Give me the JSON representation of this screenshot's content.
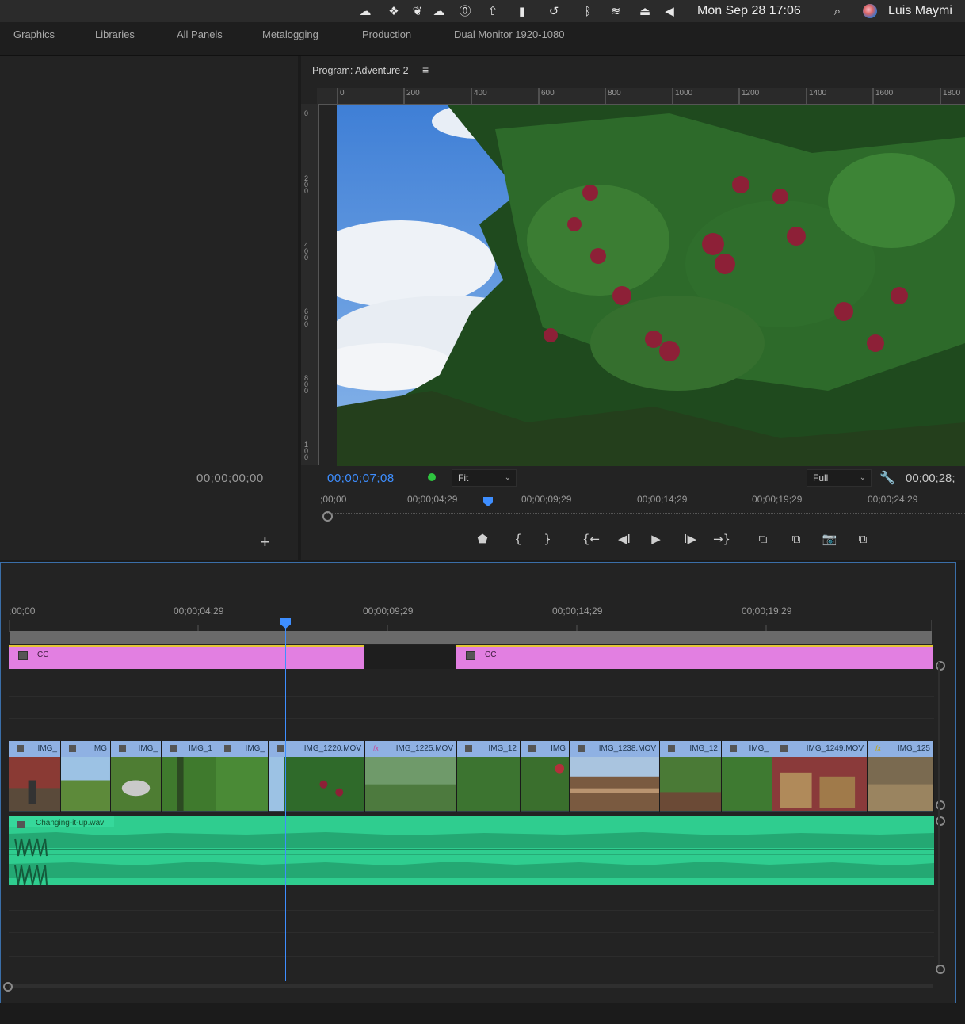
{
  "menubar": {
    "clock": "Mon Sep 28  17:06",
    "user": "Luis Maymi",
    "icons": [
      "creative-cloud-icon",
      "dropbox-icon",
      "evernote-icon",
      "cloud-icon",
      "onepassword-icon",
      "cloud-upload-icon",
      "tiles-icon",
      "time-machine-icon",
      "bluetooth-icon",
      "wifi-icon",
      "eject-icon",
      "volume-icon",
      "spotlight-search-icon",
      "user-avatar"
    ]
  },
  "workspaces": [
    "Graphics",
    "Libraries",
    "All Panels",
    "Metalogging",
    "Production",
    "Dual Monitor 1920-1080"
  ],
  "left_panel": {
    "timecode": "00;00;00;00",
    "add_symbol": "+"
  },
  "program_monitor": {
    "title": "Program: Adventure 2",
    "menu_symbol": "≡",
    "ruler_h": [
      "0",
      "200",
      "400",
      "600",
      "800",
      "1000",
      "1200",
      "1400",
      "1600",
      "1800"
    ],
    "ruler_v": [
      "0",
      "200",
      "400",
      "600",
      "800",
      "100"
    ],
    "current_timecode": "00;00;07;08",
    "fit_label": "Fit",
    "quality_label": "Full",
    "duration_timecode": "00;00;28;",
    "scrubber_ticks": [
      ";00;00",
      "00;00;04;29",
      "00;00;09;29",
      "00;00;14;29",
      "00;00;19;29",
      "00;00;24;29"
    ],
    "transport": {
      "marker": "⬟",
      "mark_in": "{",
      "mark_out": "}",
      "go_to_in": "{←",
      "step_back": "◀I",
      "play": "▶",
      "step_forward": "I▶",
      "go_to_out": "→}",
      "lift": "⧉",
      "extract": "⧉",
      "export_frame": "📷",
      "compare": "⧉"
    }
  },
  "timeline": {
    "ticks": [
      ";00;00",
      "00;00;04;29",
      "00;00;09;29",
      "00;00;14;29",
      "00;00;19;29"
    ],
    "caption_clips": [
      {
        "label": "CC"
      },
      {
        "label": "CC"
      }
    ],
    "video_clips": [
      {
        "name": "IMG_",
        "fx": false
      },
      {
        "name": "IMG",
        "fx": false
      },
      {
        "name": "IMG_",
        "fx": false
      },
      {
        "name": "IMG_1",
        "fx": false
      },
      {
        "name": "IMG_",
        "fx": false
      },
      {
        "name": "IMG_1220.MOV",
        "fx": false
      },
      {
        "name": "IMG_1225.MOV",
        "fx": true
      },
      {
        "name": "IMG_12",
        "fx": false
      },
      {
        "name": "IMG",
        "fx": false
      },
      {
        "name": "IMG_1238.MOV",
        "fx": false
      },
      {
        "name": "IMG_12",
        "fx": false
      },
      {
        "name": "IMG_",
        "fx": false
      },
      {
        "name": "IMG_1249.MOV",
        "fx": false
      },
      {
        "name": "IMG_125",
        "fx": true
      }
    ],
    "audio_clip": {
      "name": "Changing-it-up.wav"
    },
    "colors": {
      "caption": "#e27fe1",
      "video_header": "#8fb1e3",
      "audio": "#2fcd8f",
      "playhead": "#3e8eff"
    }
  }
}
